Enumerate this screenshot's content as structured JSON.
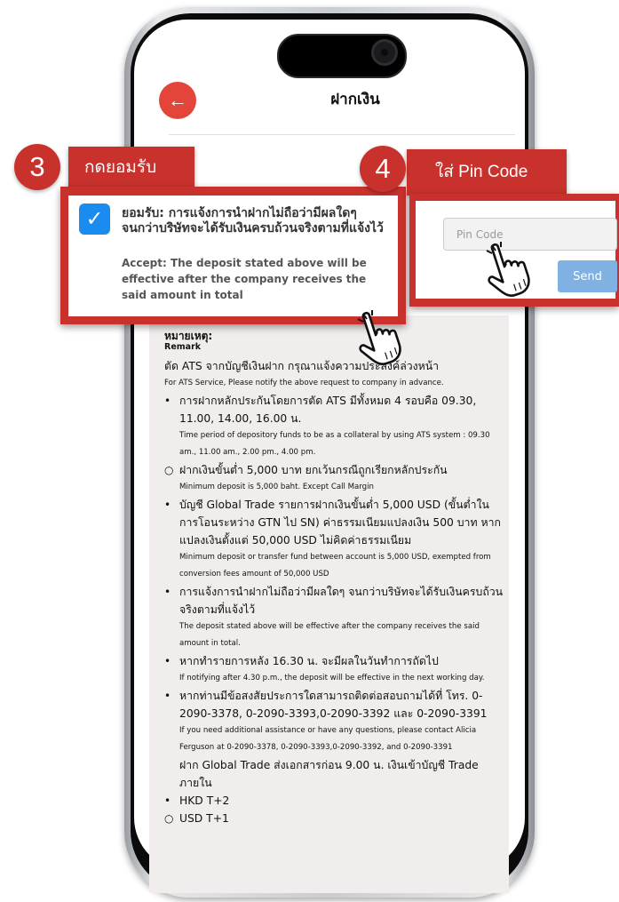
{
  "header": {
    "title": "ฝากเงิน",
    "back_icon": "←"
  },
  "callouts": {
    "step3": {
      "number": "3",
      "label": "กดยอมรับ"
    },
    "step4": {
      "number": "4",
      "label": "ใส่ Pin Code"
    }
  },
  "accept": {
    "checked": true,
    "check_icon": "✓",
    "text_th": "ยอมรับ: การแจ้งการนำฝากไม่ถือว่ามีผลใดๆ จนกว่าบริษัทจะได้รับเงินครบถ้วนจริงตามที่แจ้งไว้",
    "text_en": "Accept: The deposit stated above will be effective after the company receives the said amount in total"
  },
  "pin": {
    "placeholder": "Pin Code",
    "send_label": "Send"
  },
  "remarks": {
    "title_th": "หมายเหตุ:",
    "title_en": "Remark",
    "items": [
      {
        "bullet": "",
        "th": "ตัด ATS จากบัญชีเงินฝาก กรุณาแจ้งความประสงค์ล่วงหน้า",
        "en": "For ATS Service, Please notify the above request to company in advance."
      },
      {
        "bullet": "•",
        "th": "การฝากหลักประกันโดยการตัด ATS มีทั้งหมด 4 รอบคือ 09.30, 11.00, 14.00, 16.00 น.",
        "en": "Time period of depository funds to be as a collateral by using ATS system : 09.30 am., 11.00 am., 2.00 pm., 4.00 pm."
      },
      {
        "bullet": "○",
        "th": "ฝากเงินขั้นต่ำ 5,000 บาท ยกเว้นกรณีถูกเรียกหลักประกัน",
        "en": "Minimum deposit is 5,000 baht. Except Call Margin"
      },
      {
        "bullet": "•",
        "th": "บัญชี Global Trade รายการฝากเงินขั้นต่ำ 5,000 USD (ขั้นต่ำในการโอนระหว่าง GTN ไป SN) ค่าธรรมเนียมแปลงเงิน 500 บาท หากแปลงเงินตั้งแต่ 50,000 USD ไม่คิดค่าธรรมเนียม",
        "en": "Minimum deposit or transfer fund between account is 5,000 USD, exempted from conversion fees amount of 50,000 USD"
      },
      {
        "bullet": "•",
        "th": "การแจ้งการนำฝากไม่ถือว่ามีผลใดๆ จนกว่าบริษัทจะได้รับเงินครบถ้วนจริงตามที่แจ้งไว้",
        "en": "The deposit stated above will be effective after the company receives the said amount in total."
      },
      {
        "bullet": "•",
        "th": "หากทำรายการหลัง 16.30 น. จะมีผลในวันทำการถัดไป",
        "en": "If notifying after 4.30 p.m., the deposit will be effective in the next working day."
      },
      {
        "bullet": "•",
        "th": "หากท่านมีข้อสงสัยประการใดสามารถติดต่อสอบถามได้ที่ โทร. 0-2090-3378, 0-2090-3393,0-2090-3392 และ 0-2090-3391",
        "en": "If you need additional assistance or have any questions, please contact Alicia Ferguson at 0-2090-3378, 0-2090-3393,0-2090-3392, and 0-2090-3391"
      },
      {
        "bullet": "",
        "th": "ฝาก Global Trade ส่งเอกสารก่อน 9.00 น. เงินเข้าบัญชี Trade ภายใน",
        "en": ""
      },
      {
        "bullet": "•",
        "th": "HKD T+2",
        "en": ""
      },
      {
        "bullet": "○",
        "th": "USD T+1",
        "en": ""
      }
    ]
  },
  "colors": {
    "callout_red": "#c8312c",
    "checkbox_blue": "#1a8cf0",
    "send_blue": "#7fb1e3",
    "back_red": "#e3453a"
  }
}
